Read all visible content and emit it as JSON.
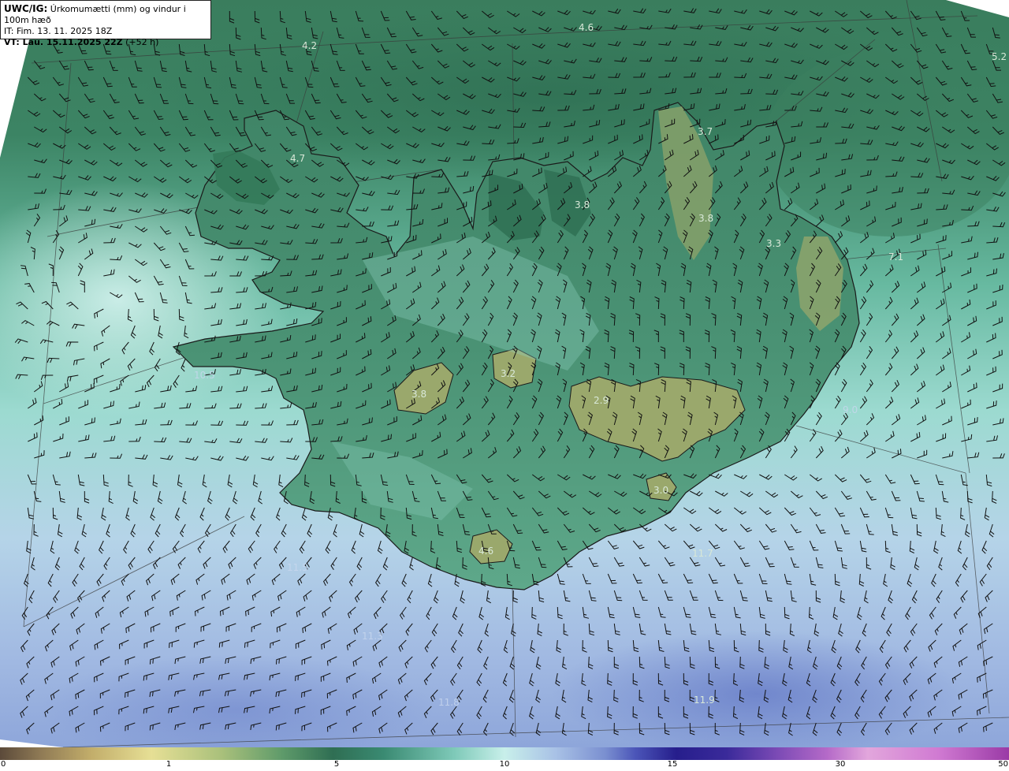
{
  "header": {
    "model_label": "UWC/IG:",
    "title": "Úrkomumætti (mm) og vindur i 100m hæð",
    "init_time": "IT: Fim. 13. 11. 2025 18Z",
    "valid_label": "VT: Lau. 15.11.2025 22Z",
    "lead_time": "(+52 h)"
  },
  "value_labels": [
    {
      "text": "4.2"
    },
    {
      "text": "4.6"
    },
    {
      "text": "5.2"
    },
    {
      "text": "4.7"
    },
    {
      "text": "3.7"
    },
    {
      "text": "3.8"
    },
    {
      "text": "3.8"
    },
    {
      "text": "3.3"
    },
    {
      "text": "7.1"
    },
    {
      "text": "3.2"
    },
    {
      "text": "3.8"
    },
    {
      "text": "2.9"
    },
    {
      "text": "3.0"
    },
    {
      "text": "4.6"
    },
    {
      "text": "11.7"
    },
    {
      "text": "11.9"
    }
  ],
  "faint_labels": [
    {
      "text": "10.5"
    },
    {
      "text": "11.5"
    },
    {
      "text": "11.3"
    },
    {
      "text": "11.8"
    },
    {
      "text": "9.0"
    }
  ],
  "colorbar": {
    "ticks": [
      "0",
      "1",
      "5",
      "10",
      "15",
      "30",
      "50"
    ],
    "colors": [
      "#5b4a3a",
      "#8f7a55",
      "#c2ad6a",
      "#e6df95",
      "#a9c07b",
      "#5e9a6a",
      "#2f6e53",
      "#3a8a72",
      "#7ec9b8",
      "#c8efea",
      "#a9c2e6",
      "#7a8fd0",
      "#4b55b8",
      "#261e8c",
      "#3a2a9a",
      "#7b4ab5",
      "#b56ac8",
      "#e2a6dc",
      "#d07ad2",
      "#9a3aa6"
    ],
    "stops": [
      0,
      0.04,
      0.09,
      0.15,
      0.22,
      0.28,
      0.33,
      0.38,
      0.45,
      0.5,
      0.55,
      0.6,
      0.63,
      0.67,
      0.72,
      0.77,
      0.82,
      0.86,
      0.93,
      1
    ]
  },
  "palette": {
    "sea_dark": "#2f6c52",
    "sea_mid": "#3f8a6e",
    "sea_light": "#9fdcd3",
    "sea_pale": "#c6eee8",
    "south_blue": "#a7c3e4",
    "land_green": "#3d8a66",
    "land_high": "#9aa86a",
    "coast": "#1a1a1a"
  }
}
